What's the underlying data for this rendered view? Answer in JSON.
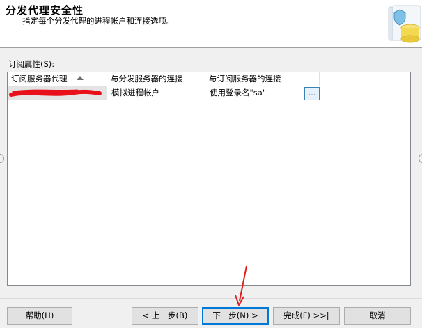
{
  "header": {
    "title": "分发代理安全性",
    "subtitle": "指定每个分发代理的进程帐户和连接选项。",
    "graphic_icon": "database-shield-icon"
  },
  "main": {
    "props_label": "订阅属性(S):",
    "columns": [
      "订阅服务器代理",
      "与分发服务器的连接",
      "与订阅服务器的连接"
    ],
    "sort_icon": "sort-ascending-icon",
    "rows": [
      {
        "agent": "",
        "dist_conn": "模拟进程帐户",
        "sub_conn": "使用登录名\"sa\"",
        "action_label": "..."
      }
    ]
  },
  "footer": {
    "help": "帮助(H)",
    "back": "< 上一步(B)",
    "next": "下一步(N) >",
    "finish": "完成(F) >>|",
    "cancel": "取消"
  },
  "colors": {
    "accent": "#0078d7",
    "redaction": "#e8101a",
    "annotation_arrow": "#e02020"
  }
}
